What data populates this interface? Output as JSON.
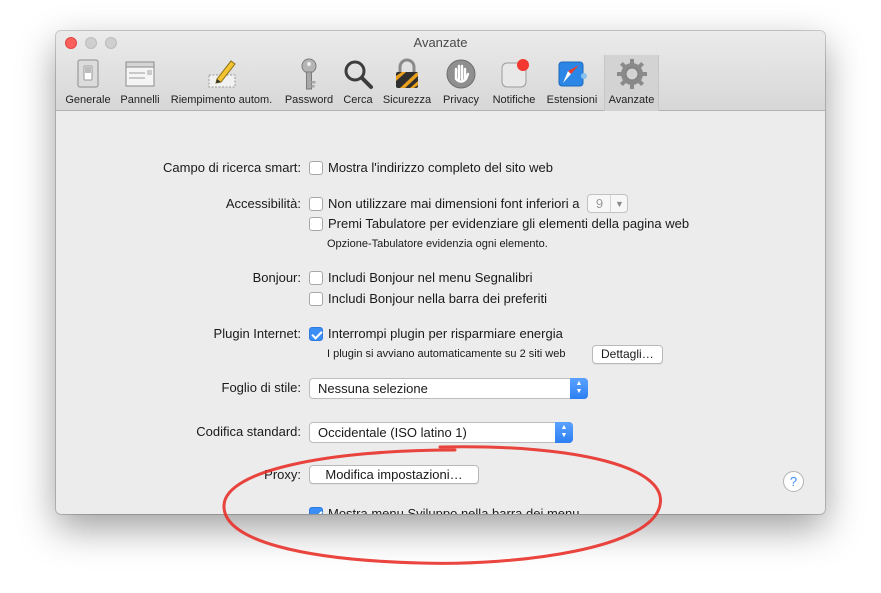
{
  "window": {
    "title": "Avanzate"
  },
  "toolbar": {
    "tabs": [
      {
        "label": "Generale",
        "icon": "switch-icon"
      },
      {
        "label": "Pannelli",
        "icon": "window-panel-icon"
      },
      {
        "label": "Riempimento autom.",
        "icon": "pencil-form-icon"
      },
      {
        "label": "Password",
        "icon": "key-icon"
      },
      {
        "label": "Cerca",
        "icon": "magnifier-icon"
      },
      {
        "label": "Sicurezza",
        "icon": "padlock-icon"
      },
      {
        "label": "Privacy",
        "icon": "hand-icon"
      },
      {
        "label": "Notifiche",
        "icon": "notification-badge-icon"
      },
      {
        "label": "Estensioni",
        "icon": "compass-puzzle-icon"
      },
      {
        "label": "Avanzate",
        "icon": "gear-icon",
        "selected": true
      }
    ]
  },
  "settings": {
    "smart_search": {
      "label": "Campo di ricerca smart:",
      "show_full_address": {
        "text": "Mostra l'indirizzo completo del sito web",
        "checked": false
      }
    },
    "accessibility": {
      "label": "Accessibilità:",
      "min_font": {
        "text": "Non utilizzare mai dimensioni font inferiori a",
        "checked": false,
        "size_value": "9"
      },
      "tab_highlight": {
        "text": "Premi Tabulatore per evidenziare gli elementi della pagina web",
        "checked": false
      },
      "note": "Opzione-Tabulatore evidenzia ogni elemento."
    },
    "bonjour": {
      "label": "Bonjour:",
      "in_bookmarks_menu": {
        "text": "Includi Bonjour nel menu Segnalibri",
        "checked": false
      },
      "in_favorites_bar": {
        "text": "Includi Bonjour nella barra dei preferiti",
        "checked": false
      }
    },
    "plugins": {
      "label": "Plugin Internet:",
      "stop_plugins": {
        "text": "Interrompi plugin per risparmiare energia",
        "checked": true
      },
      "note": "I plugin si avviano automaticamente su 2 siti web",
      "details_button": "Dettagli…"
    },
    "stylesheet": {
      "label": "Foglio di stile:",
      "value": "Nessuna selezione"
    },
    "encoding": {
      "label": "Codifica standard:",
      "value": "Occidentale (ISO latino 1)"
    },
    "proxy": {
      "label": "Proxy:",
      "button": "Modifica impostazioni…"
    },
    "develop_menu": {
      "text": "Mostra menu Sviluppo nella barra dei menu",
      "checked": true
    },
    "help_button": "?"
  },
  "colors": {
    "accent": "#3b8ef6",
    "annotation": "#e8312a",
    "close": "#fc605c"
  }
}
